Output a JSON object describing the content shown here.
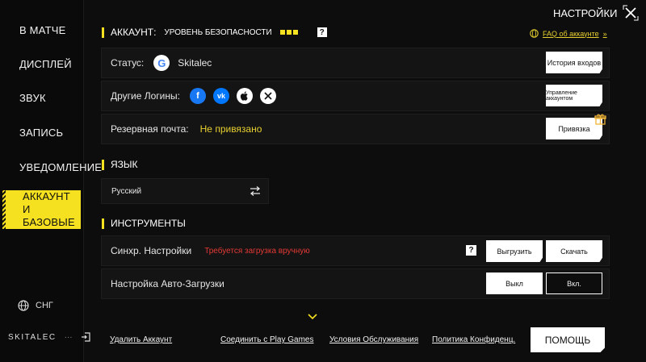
{
  "header": {
    "title": "НАСТРОЙКИ"
  },
  "sidebar": {
    "items": [
      {
        "label": "В МАТЧЕ"
      },
      {
        "label": "ДИСПЛЕЙ"
      },
      {
        "label": "ЗВУК"
      },
      {
        "label": "ЗАПИСЬ"
      },
      {
        "label": "УВЕДОМЛЕНИЕ"
      },
      {
        "label": "АККАУНТ И БАЗОВЫЕ"
      }
    ],
    "region": "СНГ",
    "username": "SKITALEC",
    "dots": "···"
  },
  "account": {
    "title": "АККАУНТ:",
    "security_label": "УРОВЕНЬ БЕЗОПАСНОСТИ",
    "help_mark": "?",
    "faq": "FAQ об аккаунте",
    "faq_arrow": "»",
    "status_label": "Статус:",
    "status_name": "Skitalec",
    "history_button": "История входов",
    "logins_label": "Другие Логины:",
    "manage_button": "Управление аккаунтом",
    "email_label": "Резервная почта:",
    "email_value": "Не привязано",
    "bind_button": "Привязка"
  },
  "language": {
    "title": "ЯЗЫК",
    "value": "Русский"
  },
  "tools": {
    "title": "ИНСТРУМЕНТЫ",
    "sync_label": "Синхр. Настройки",
    "sync_warning": "Требуется загрузка вручную",
    "help_mark": "?",
    "upload_button": "Выгрузить",
    "download_button": "Скачать",
    "autoload_label": "Настройка Авто-Загрузки",
    "off_button": "Выкл",
    "on_button": "Вкл."
  },
  "footer": {
    "delete": "Удалить Аккаунт",
    "connect": "Соединить с Play Games",
    "terms": "Условия Обслуживания",
    "privacy": "Политика Конфиденц.",
    "help": "ПОМОЩЬ"
  },
  "colors": {
    "accent": "#f5e11f",
    "warning": "#e53935",
    "email_value": "#e7d030"
  }
}
